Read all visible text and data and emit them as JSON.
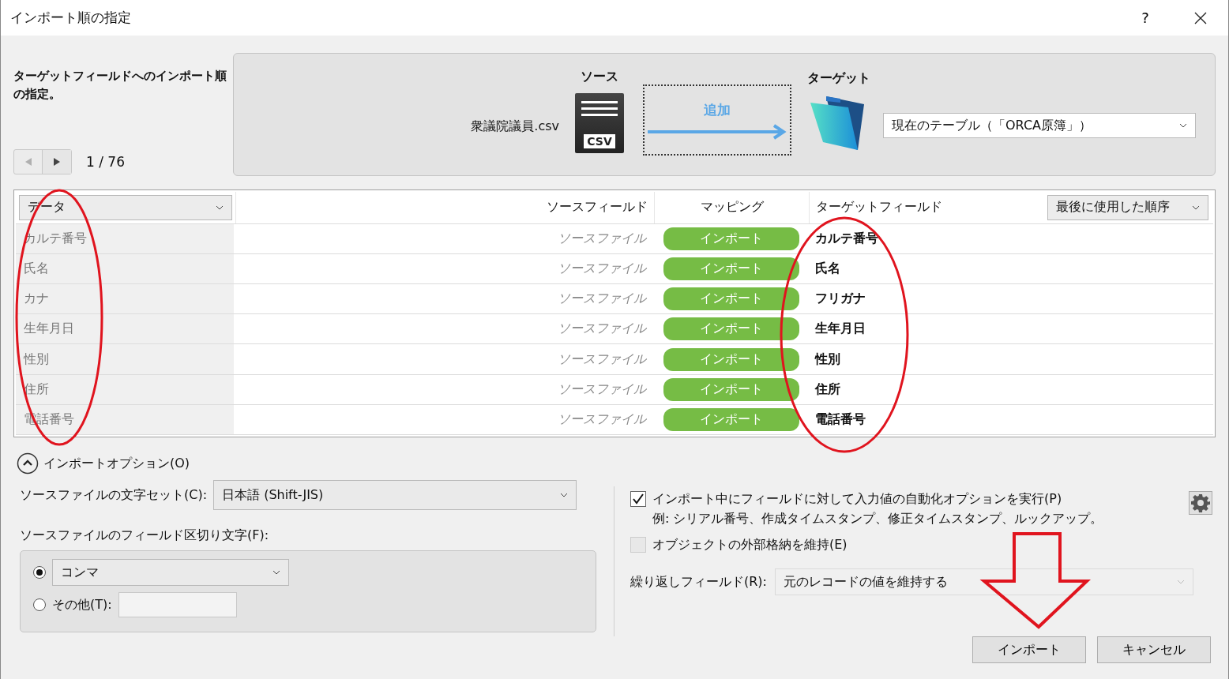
{
  "window": {
    "title": "インポート順の指定",
    "help": "?"
  },
  "intro": {
    "description": "ターゲットフィールドへのインポート順の指定。",
    "counter": "1 / 76"
  },
  "source": {
    "heading": "ソース",
    "file": "衆議院議員.csv",
    "icon_label": "CSV"
  },
  "action": {
    "label": "追加"
  },
  "target": {
    "heading": "ターゲット",
    "table": "現在のテーブル（「ORCA原簿」）"
  },
  "table": {
    "columns": [
      {
        "kind": "dropdown",
        "label": "データ"
      },
      {
        "kind": "text",
        "label": "ソースフィールド"
      },
      {
        "kind": "text",
        "label": "マッピング"
      },
      {
        "kind": "text",
        "label": "ターゲットフィールド"
      },
      {
        "kind": "dropdown",
        "label": "最後に使用した順序"
      }
    ],
    "rows": [
      {
        "data": "カルテ番号",
        "source": "ソースファイル",
        "mapping": "インポート",
        "target": "カルテ番号"
      },
      {
        "data": "氏名",
        "source": "ソースファイル",
        "mapping": "インポート",
        "target": "氏名"
      },
      {
        "data": "カナ",
        "source": "ソースファイル",
        "mapping": "インポート",
        "target": "フリガナ"
      },
      {
        "data": "生年月日",
        "source": "ソースファイル",
        "mapping": "インポート",
        "target": "生年月日"
      },
      {
        "data": "性別",
        "source": "ソースファイル",
        "mapping": "インポート",
        "target": "性別"
      },
      {
        "data": "住所",
        "source": "ソースファイル",
        "mapping": "インポート",
        "target": "住所"
      },
      {
        "data": "電話番号",
        "source": "ソースファイル",
        "mapping": "インポート",
        "target": "電話番号"
      }
    ]
  },
  "options": {
    "title": "インポートオプション(O)",
    "expanded": true,
    "charset": {
      "label": "ソースファイルの文字セット(C):",
      "value": "日本語 (Shift-JIS)"
    },
    "delimiter": {
      "label": "ソースファイルのフィールド区切り文字(F):",
      "choices": [
        {
          "kind": "select",
          "value": "コンマ",
          "selected": true
        },
        {
          "kind": "input",
          "label": "その他(T):",
          "selected": false
        }
      ]
    },
    "checks": [
      {
        "label": "インポート中にフィールドに対して入力値の自動化オプションを実行(P)",
        "note": "例: シリアル番号、作成タイムスタンプ、修正タイムスタンプ、ルックアップ。",
        "checked": true
      },
      {
        "label": "オブジェクトの外部格納を維持(E)",
        "checked": false
      }
    ],
    "repeat": {
      "label": "繰り返しフィールド(R):",
      "value": "元のレコードの値を維持する"
    }
  },
  "buttons": [
    {
      "label": "インポート"
    },
    {
      "label": "キャンセル"
    }
  ]
}
